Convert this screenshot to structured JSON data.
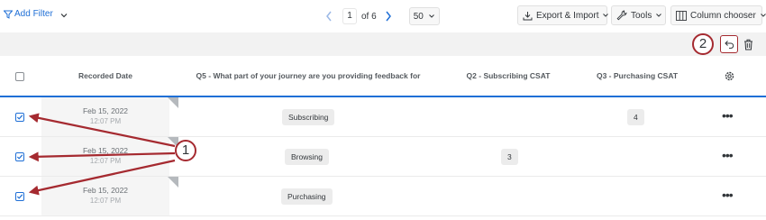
{
  "toolbar": {
    "add_filter_label": "Add Filter",
    "pagination": {
      "current_page": "1",
      "of_label": "of 6",
      "per_page": "50"
    },
    "export_label": "Export & Import",
    "tools_label": "Tools",
    "column_chooser_label": "Column chooser"
  },
  "table": {
    "columns": [
      "Recorded Date",
      "Q5 - What part of your journey are you providing feedback for",
      "Q2 - Subscribing CSAT",
      "Q3 - Purchasing CSAT"
    ],
    "rows": [
      {
        "date": "Feb 15, 2022",
        "time": "12:07 PM",
        "q5": "Subscribing",
        "q2": "",
        "q3": "4",
        "checked": true
      },
      {
        "date": "Feb 15, 2022",
        "time": "12:07 PM",
        "q5": "Browsing",
        "q2": "3",
        "q3": "",
        "checked": true
      },
      {
        "date": "Feb 15, 2022",
        "time": "12:07 PM",
        "q5": "Purchasing",
        "q2": "",
        "q3": "",
        "checked": true
      }
    ],
    "row_menu_label": "•••"
  },
  "callouts": {
    "rows": "1",
    "undo": "2"
  },
  "icons": {
    "filter": "filter-icon",
    "chevron": "chevron-down-icon",
    "prev": "chevron-left-icon",
    "next": "chevron-right-icon",
    "export": "download-icon",
    "tools": "wrench-icon",
    "columns": "columns-icon",
    "undo": "undo-icon",
    "trash": "trash-icon",
    "settings": "gear-icon"
  },
  "colors": {
    "accent": "#1f6fd6",
    "annotation": "#a52a30",
    "subbar": "#f2f2f2"
  }
}
